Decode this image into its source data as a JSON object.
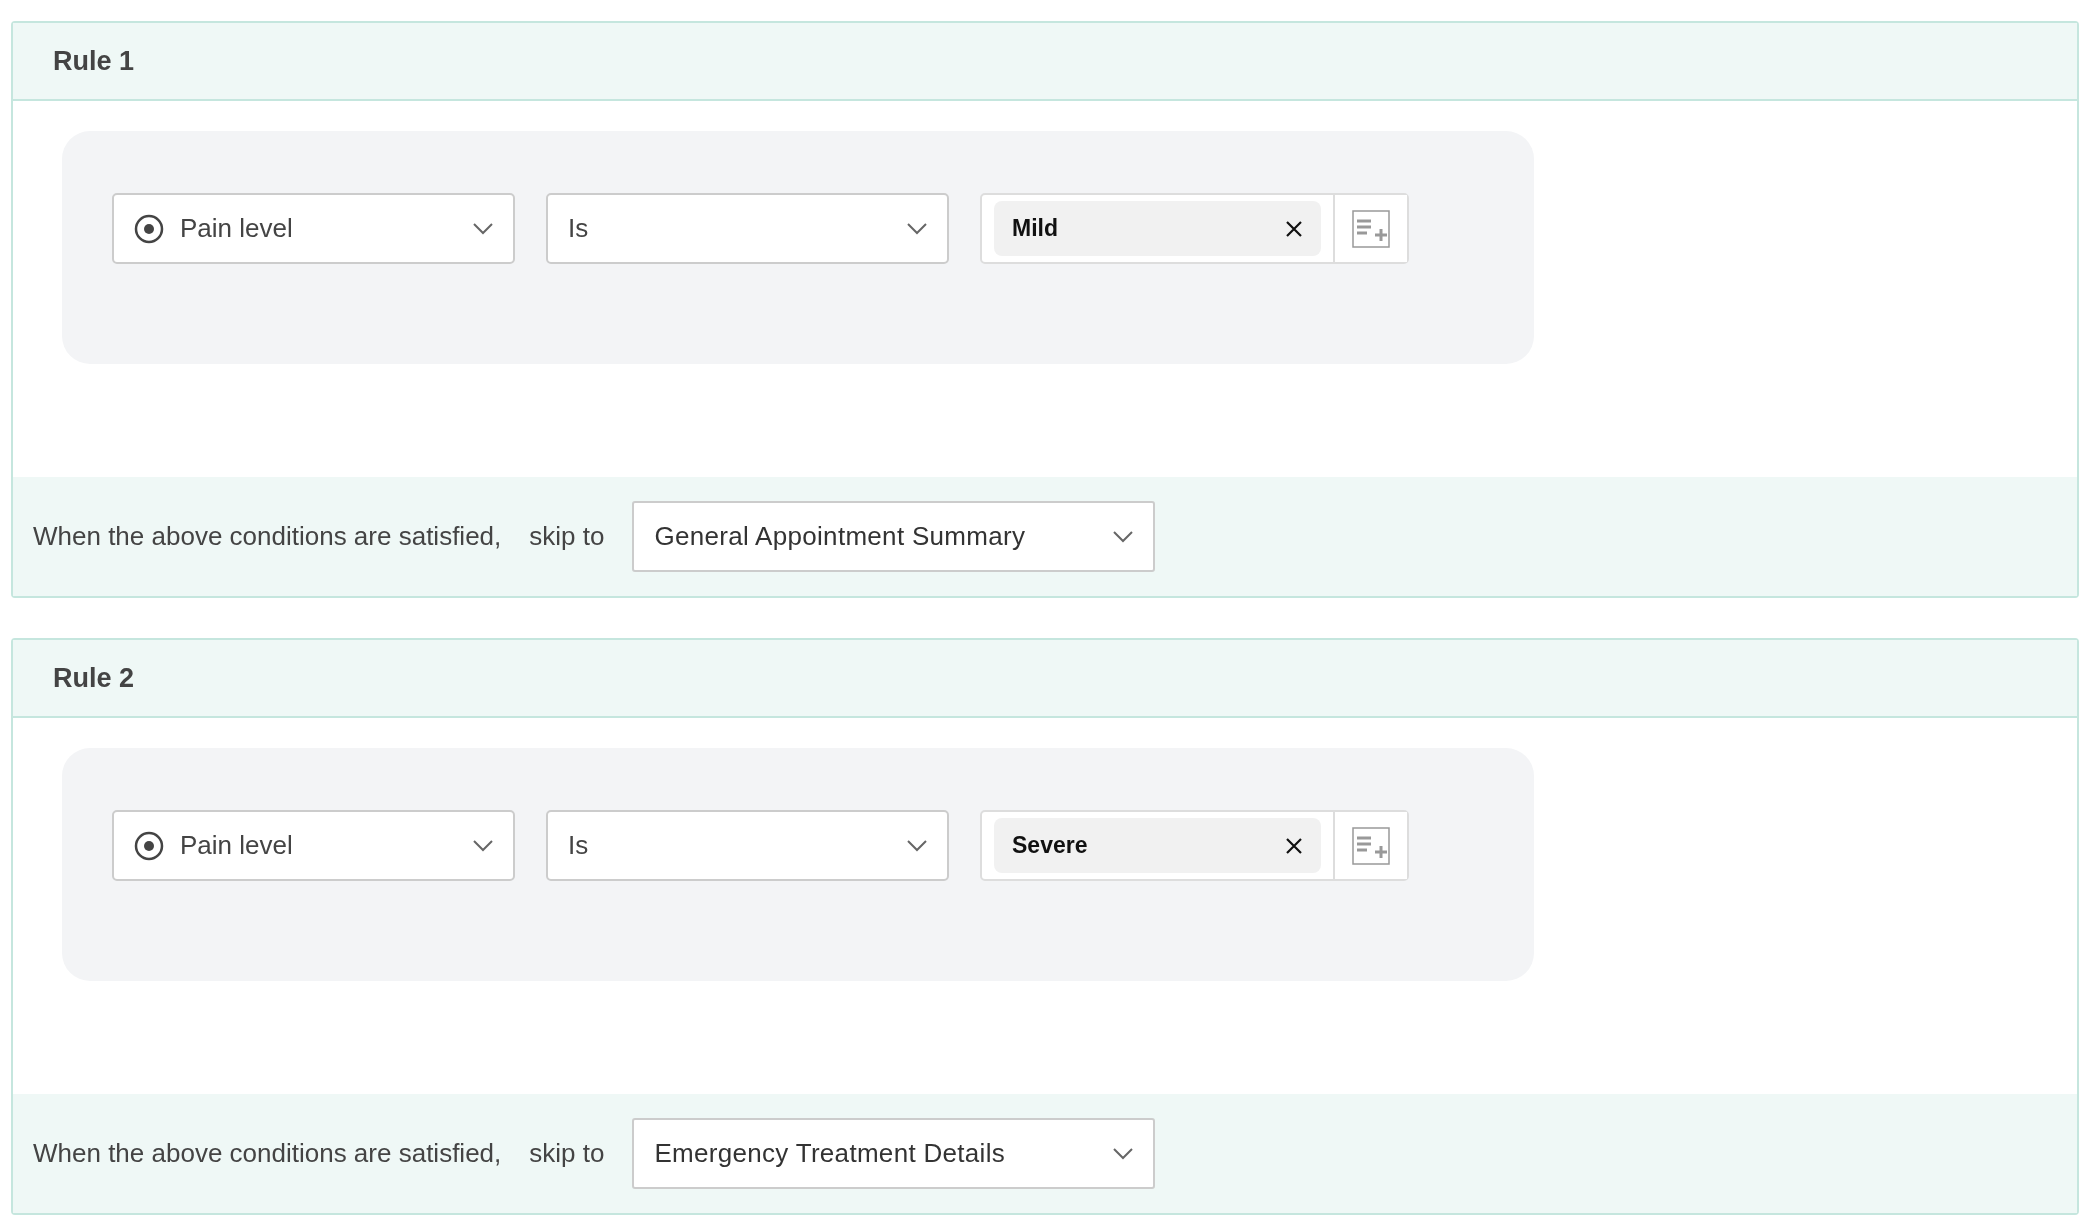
{
  "rules": [
    {
      "title": "Rule 1",
      "condition": {
        "field": "Pain level",
        "operator": "Is",
        "values": [
          "Mild"
        ]
      },
      "action": {
        "text": "When the above conditions are satisfied,",
        "skip_label": "skip to",
        "target": "General Appointment Summary"
      }
    },
    {
      "title": "Rule 2",
      "condition": {
        "field": "Pain level",
        "operator": "Is",
        "values": [
          "Severe"
        ]
      },
      "action": {
        "text": "When the above conditions are satisfied,",
        "skip_label": "skip to",
        "target": "Emergency Treatment Details"
      }
    }
  ]
}
